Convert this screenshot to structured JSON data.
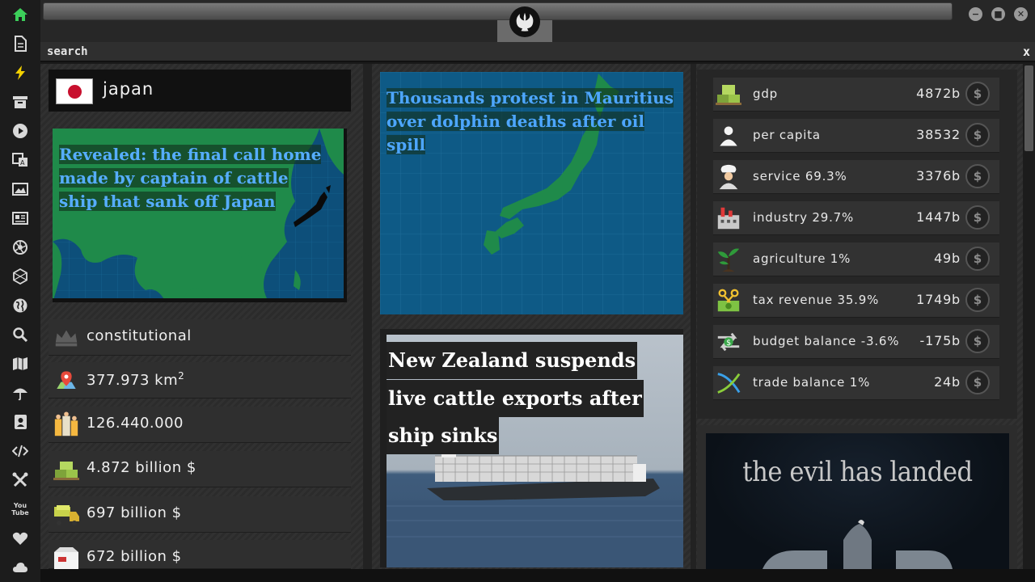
{
  "rail": {
    "icons": [
      "home-icon",
      "document-icon",
      "lightning-icon",
      "archive-icon",
      "play-icon",
      "translate-icon",
      "image-icon",
      "newspaper-icon",
      "aperture-icon",
      "hexagon-icon",
      "globe-icon",
      "search-icon",
      "map-icon",
      "umbrella-icon",
      "contact-icon",
      "code-icon",
      "tools-icon",
      "youtube-icon",
      "heart-icon",
      "cloud-icon"
    ],
    "youtube_label": "You Tube"
  },
  "search": {
    "label": "search",
    "close": "x"
  },
  "country": {
    "name": "japan",
    "flag": "japan-flag"
  },
  "news": {
    "asia_headline": "Revealed: the final call home made by captain of cattle ship that sank off Japan",
    "japan_headline": "Thousands protest in Mauritius over dolphin deaths after oil spill",
    "ship_headline_lines": [
      "New Zealand suspends",
      "live cattle exports after",
      "ship sinks"
    ]
  },
  "stats": [
    {
      "icon": "crown-icon",
      "text": "constitutional"
    },
    {
      "icon": "area-pin-icon",
      "text": "377.973 km",
      "sup": "2"
    },
    {
      "icon": "population-icon",
      "text": "126.440.000"
    },
    {
      "icon": "money-stack-icon",
      "text": "4.872 billion $"
    },
    {
      "icon": "money-truck-icon",
      "text": "697 billion $"
    },
    {
      "icon": "export-box-icon",
      "text": "672 billion $"
    }
  ],
  "economy": [
    {
      "icon": "money-stack-icon",
      "label": "gdp",
      "value": "4872b"
    },
    {
      "icon": "person-icon",
      "label": "per capita",
      "value": "38532"
    },
    {
      "icon": "chef-icon",
      "label": "service 69.3%",
      "value": "3376b"
    },
    {
      "icon": "factory-icon",
      "label": "industry 29.7%",
      "value": "1447b"
    },
    {
      "icon": "plant-icon",
      "label": "agriculture 1%",
      "value": "49b"
    },
    {
      "icon": "scissors-money-icon",
      "label": "tax revenue 35.9%",
      "value": "1749b"
    },
    {
      "icon": "balance-arrows-icon",
      "label": "budget balance -3.6%",
      "value": "-175b"
    },
    {
      "icon": "trade-cross-icon",
      "label": "trade balance 1%",
      "value": "24b"
    }
  ],
  "coin_symbol": "$",
  "ad": {
    "text": "the evil has landed"
  }
}
